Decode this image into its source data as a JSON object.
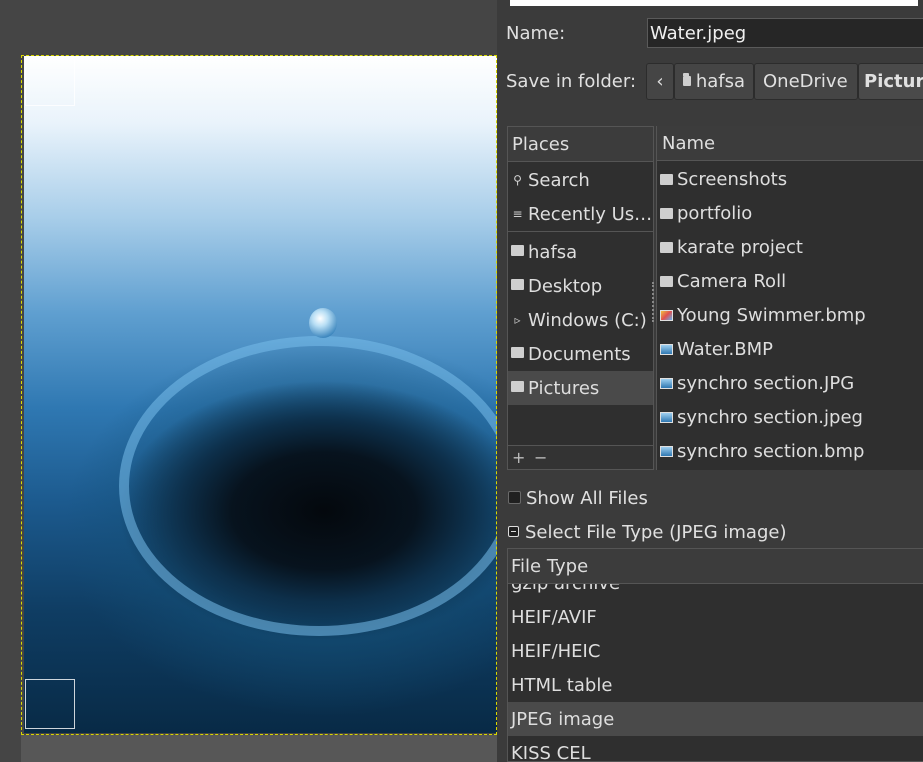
{
  "save_dialog": {
    "name_label": "Name:",
    "filename": "Water.jpeg",
    "folder_label": "Save in folder:",
    "breadcrumbs": [
      {
        "label": "hafsa",
        "icon": "folder-icon"
      },
      {
        "label": "OneDrive"
      },
      {
        "label": "Pictur",
        "active": true
      }
    ],
    "places_header": "Places",
    "places": [
      {
        "label": "Search",
        "icon": "search-icon"
      },
      {
        "label": "Recently Us…",
        "icon": "recent-icon"
      },
      {
        "label": "hafsa",
        "icon": "folder-icon"
      },
      {
        "label": "Desktop",
        "icon": "folder-icon"
      },
      {
        "label": "Windows (C:)",
        "icon": "drive-icon"
      },
      {
        "label": "Documents",
        "icon": "folder-icon"
      },
      {
        "label": "Pictures",
        "icon": "folder-icon",
        "selected": true
      }
    ],
    "places_footer": {
      "add": "+",
      "remove": "−"
    },
    "files_header": "Name",
    "files": [
      {
        "name": "Screenshots",
        "icon": "folder-icon"
      },
      {
        "name": "portfolio",
        "icon": "folder-icon"
      },
      {
        "name": "karate project",
        "icon": "folder-icon"
      },
      {
        "name": "Camera Roll",
        "icon": "folder-icon"
      },
      {
        "name": "Young Swimmer.bmp",
        "icon": "image-file-icon"
      },
      {
        "name": "Water.BMP",
        "icon": "image-file-icon"
      },
      {
        "name": "synchro section.JPG",
        "icon": "image-file-icon"
      },
      {
        "name": "synchro section.jpeg",
        "icon": "image-file-icon"
      },
      {
        "name": "synchro section.bmp",
        "icon": "image-file-icon"
      }
    ],
    "show_all_files": {
      "label": "Show All Files",
      "checked": false
    },
    "select_file_type": "Select File Type (JPEG image)",
    "file_type_header": "File Type",
    "file_types": [
      {
        "label": "gzip archive"
      },
      {
        "label": "HEIF/AVIF"
      },
      {
        "label": "HEIF/HEIC"
      },
      {
        "label": "HTML table"
      },
      {
        "label": "JPEG image",
        "selected": true
      },
      {
        "label": "KISS CEL"
      }
    ]
  }
}
